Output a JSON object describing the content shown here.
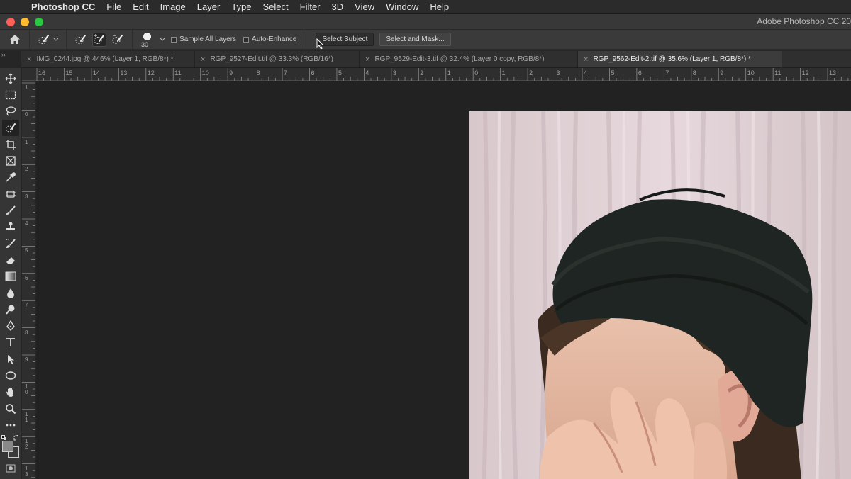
{
  "menubar": {
    "app_name": "Photoshop CC",
    "items": [
      "File",
      "Edit",
      "Image",
      "Layer",
      "Type",
      "Select",
      "Filter",
      "3D",
      "View",
      "Window",
      "Help"
    ]
  },
  "window": {
    "title": "Adobe Photoshop CC 20"
  },
  "options": {
    "brush_size": "30",
    "sample_all_layers": "Sample All Layers",
    "auto_enhance": "Auto-Enhance",
    "select_subject": "Select Subject",
    "select_and_mask": "Select and Mask..."
  },
  "tabs": [
    {
      "label": "IMG_0244.jpg @ 446% (Layer 1, RGB/8*) *",
      "active": false
    },
    {
      "label": "RGP_9527-Edit.tif @ 33.3% (RGB/16*)",
      "active": false
    },
    {
      "label": "RGP_9529-Edit-3.tif @ 32.4% (Layer 0 copy, RGB/8*)",
      "active": false
    },
    {
      "label": "RGP_9562-Edit-2.tif @ 35.6% (Layer 1, RGB/8*) *",
      "active": true
    }
  ],
  "ruler_top_labels": [
    "16",
    "15",
    "14",
    "13",
    "12",
    "11",
    "10",
    "9",
    "8",
    "7",
    "6",
    "5",
    "4",
    "3",
    "2",
    "1",
    "0",
    "1",
    "2",
    "3",
    "4",
    "5",
    "6",
    "7",
    "8",
    "9",
    "10",
    "11",
    "12",
    "13"
  ],
  "ruler_left_labels": [
    "1",
    "0",
    "1",
    "2",
    "3",
    "4",
    "5",
    "6",
    "7",
    "8",
    "9",
    "1 0",
    "1 1",
    "1 2",
    "1 3"
  ],
  "tools": [
    "move-icon",
    "marquee-icon",
    "lasso-icon",
    "quick-selection-icon",
    "crop-icon",
    "frame-icon",
    "eyedropper-icon",
    "healing-brush-icon",
    "brush-icon",
    "clone-stamp-icon",
    "history-brush-icon",
    "eraser-icon",
    "gradient-icon",
    "blur-icon",
    "dodge-icon",
    "pen-icon",
    "type-icon",
    "path-selection-icon",
    "ellipse-icon",
    "hand-icon",
    "zoom-icon",
    "more-tools-icon"
  ],
  "colors": {
    "foreground": "#888888",
    "background": "#3a3a3a",
    "canvas": "#222222"
  }
}
